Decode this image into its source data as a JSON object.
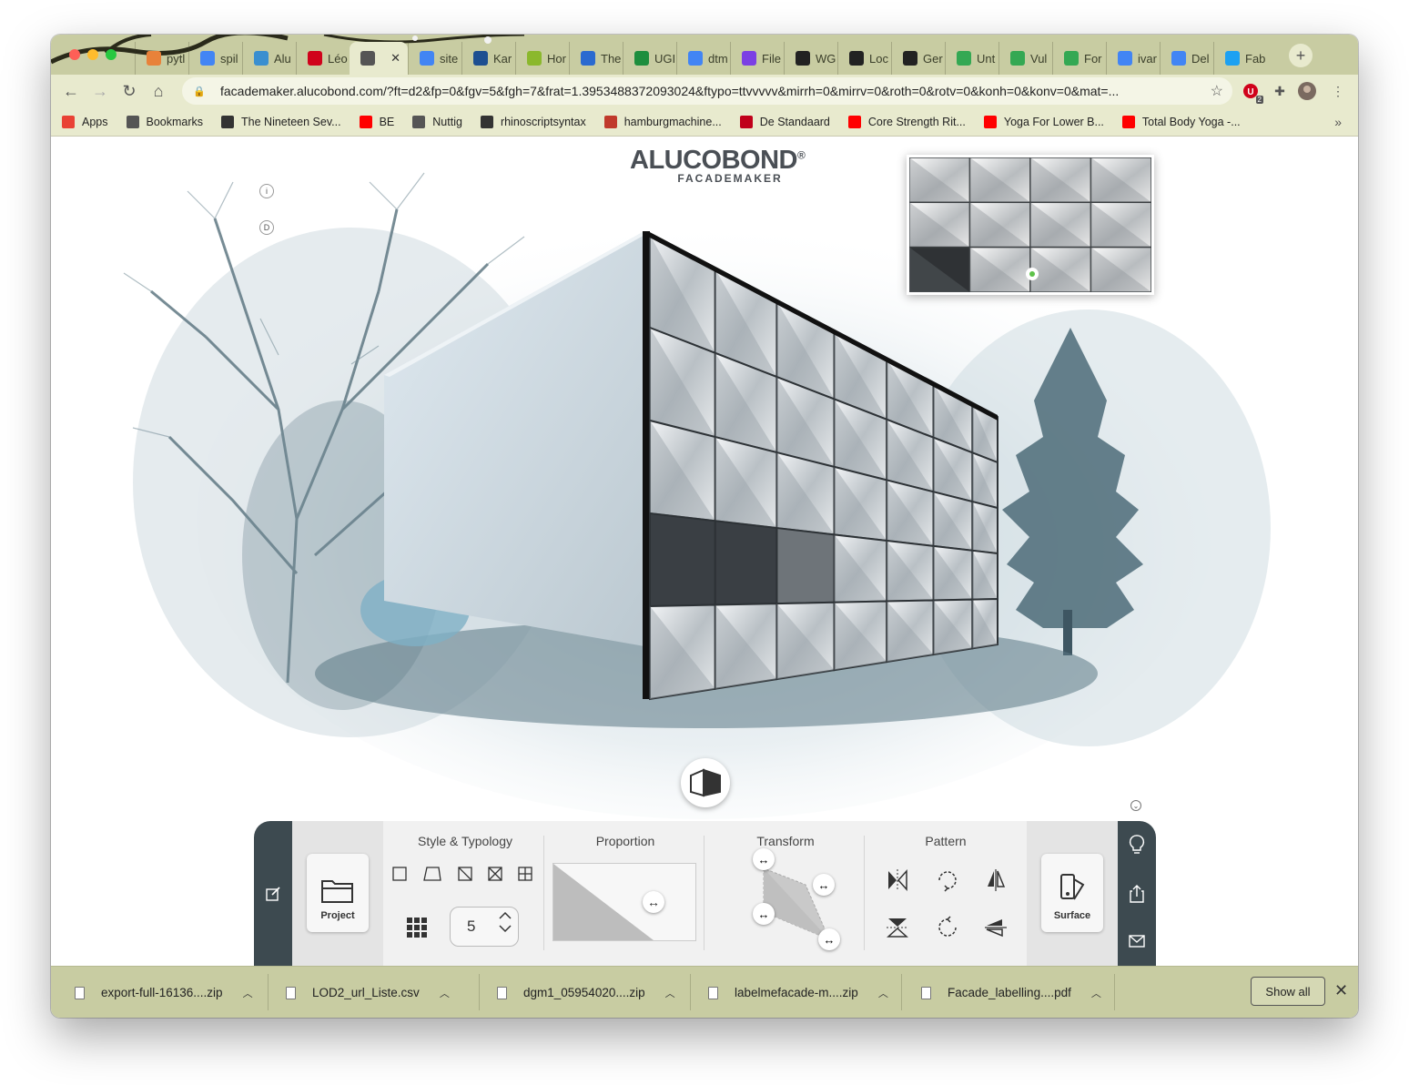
{
  "browser": {
    "tabs": [
      {
        "label": "pytl",
        "icon": "flame-icon",
        "color": "#e8823a"
      },
      {
        "label": "spil",
        "icon": "google-icon",
        "color": "#4285f4"
      },
      {
        "label": "Alu",
        "icon": "alucobond-icon",
        "color": "#3a8fd0"
      },
      {
        "label": "Léo",
        "icon": "leo-icon",
        "color": "#d0021b"
      },
      {
        "label": "",
        "icon": "globe-icon",
        "color": "#555555",
        "active": true
      },
      {
        "label": "site",
        "icon": "google-icon",
        "color": "#4285f4"
      },
      {
        "label": "Kar",
        "icon": "kar-icon",
        "color": "#1d4f91"
      },
      {
        "label": "Hor",
        "icon": "geo-icon",
        "color": "#8bb82d"
      },
      {
        "label": "The",
        "icon": "the-icon",
        "color": "#2a6ad0"
      },
      {
        "label": "UGI",
        "icon": "ugi-icon",
        "color": "#1e8e3e"
      },
      {
        "label": "dtm",
        "icon": "google-icon",
        "color": "#4285f4"
      },
      {
        "label": "File",
        "icon": "file-icon",
        "color": "#7b3fe4"
      },
      {
        "label": "WG",
        "icon": "ronorp-icon",
        "color": "#222222"
      },
      {
        "label": "Loc",
        "icon": "ronorp-icon",
        "color": "#222222"
      },
      {
        "label": "Ger",
        "icon": "ronorp-icon",
        "color": "#222222"
      },
      {
        "label": "Unt",
        "icon": "maps-icon",
        "color": "#34a853"
      },
      {
        "label": "Vul",
        "icon": "maps-icon",
        "color": "#34a853"
      },
      {
        "label": "For",
        "icon": "maps-icon",
        "color": "#34a853"
      },
      {
        "label": "ivar",
        "icon": "google-icon",
        "color": "#4285f4"
      },
      {
        "label": "Del",
        "icon": "google-icon",
        "color": "#4285f4"
      },
      {
        "label": "Fab",
        "icon": "twitter-icon",
        "color": "#1da1f2"
      }
    ],
    "url": "facademaker.alucobond.com/?ft=d2&fp=0&fgv=5&fgh=7&frat=1.3953488372093024&ftypo=ttvvvvv&mirrh=0&mirrv=0&roth=0&rotv=0&konh=0&konv=0&mat=...",
    "extension_badge": "2",
    "bookmarks": [
      {
        "label": "Apps",
        "icon": "apps-grid-icon",
        "color": "#e94235"
      },
      {
        "label": "Bookmarks",
        "icon": "star-icon",
        "color": "#555555"
      },
      {
        "label": "The Nineteen Sev...",
        "icon": "cube-icon",
        "color": "#333333"
      },
      {
        "label": "BE",
        "icon": "youtube-icon",
        "color": "#ff0000"
      },
      {
        "label": "Nuttig",
        "icon": "folder-icon",
        "color": "#555555"
      },
      {
        "label": "rhinoscriptsyntax",
        "icon": "rhino-icon",
        "color": "#333333"
      },
      {
        "label": "hamburgmachine...",
        "icon": "hamburg-icon",
        "color": "#c0392b"
      },
      {
        "label": "De Standaard",
        "icon": "ds-icon",
        "color": "#c0001a"
      },
      {
        "label": "Core Strength Rit...",
        "icon": "youtube-icon",
        "color": "#ff0000"
      },
      {
        "label": "Yoga For Lower B...",
        "icon": "youtube-icon",
        "color": "#ff0000"
      },
      {
        "label": "Total Body Yoga -...",
        "icon": "youtube-icon",
        "color": "#ff0000"
      }
    ]
  },
  "app": {
    "brand": "ALUCOBOND",
    "brand_mark": "®",
    "subtitle": "FACADEMAKER",
    "info_button": "i",
    "d_button": "D",
    "panel": {
      "project_label": "Project",
      "surface_label": "Surface",
      "sections": {
        "style": "Style & Typology",
        "proportion": "Proportion",
        "transform": "Transform",
        "pattern": "Pattern"
      },
      "grid_count": "5"
    }
  },
  "downloads": {
    "items": [
      {
        "name": "export-full-16136....zip"
      },
      {
        "name": "LOD2_url_Liste.csv"
      },
      {
        "name": "dgm1_05954020....zip"
      },
      {
        "name": "labelmefacade-m....zip"
      },
      {
        "name": "Facade_labelling....pdf"
      }
    ],
    "show_all": "Show all"
  },
  "colors": {
    "chrome_frame": "#c8cca2",
    "toolbar": "#e8eace",
    "panel_dark": "#3d4a50",
    "accent_green": "#5ec24a"
  }
}
